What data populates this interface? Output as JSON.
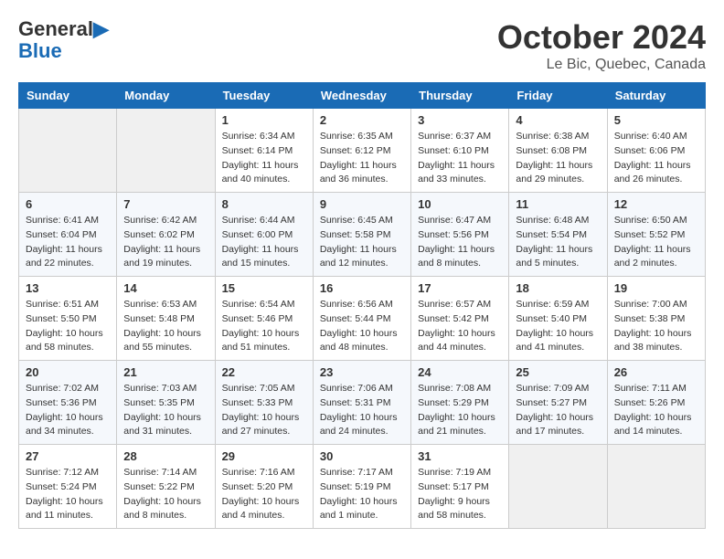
{
  "header": {
    "logo_line1": "General",
    "logo_line2": "Blue",
    "month": "October 2024",
    "location": "Le Bic, Quebec, Canada"
  },
  "days_of_week": [
    "Sunday",
    "Monday",
    "Tuesday",
    "Wednesday",
    "Thursday",
    "Friday",
    "Saturday"
  ],
  "weeks": [
    [
      {
        "num": "",
        "sunrise": "",
        "sunset": "",
        "daylight": ""
      },
      {
        "num": "",
        "sunrise": "",
        "sunset": "",
        "daylight": ""
      },
      {
        "num": "1",
        "sunrise": "Sunrise: 6:34 AM",
        "sunset": "Sunset: 6:14 PM",
        "daylight": "Daylight: 11 hours and 40 minutes."
      },
      {
        "num": "2",
        "sunrise": "Sunrise: 6:35 AM",
        "sunset": "Sunset: 6:12 PM",
        "daylight": "Daylight: 11 hours and 36 minutes."
      },
      {
        "num": "3",
        "sunrise": "Sunrise: 6:37 AM",
        "sunset": "Sunset: 6:10 PM",
        "daylight": "Daylight: 11 hours and 33 minutes."
      },
      {
        "num": "4",
        "sunrise": "Sunrise: 6:38 AM",
        "sunset": "Sunset: 6:08 PM",
        "daylight": "Daylight: 11 hours and 29 minutes."
      },
      {
        "num": "5",
        "sunrise": "Sunrise: 6:40 AM",
        "sunset": "Sunset: 6:06 PM",
        "daylight": "Daylight: 11 hours and 26 minutes."
      }
    ],
    [
      {
        "num": "6",
        "sunrise": "Sunrise: 6:41 AM",
        "sunset": "Sunset: 6:04 PM",
        "daylight": "Daylight: 11 hours and 22 minutes."
      },
      {
        "num": "7",
        "sunrise": "Sunrise: 6:42 AM",
        "sunset": "Sunset: 6:02 PM",
        "daylight": "Daylight: 11 hours and 19 minutes."
      },
      {
        "num": "8",
        "sunrise": "Sunrise: 6:44 AM",
        "sunset": "Sunset: 6:00 PM",
        "daylight": "Daylight: 11 hours and 15 minutes."
      },
      {
        "num": "9",
        "sunrise": "Sunrise: 6:45 AM",
        "sunset": "Sunset: 5:58 PM",
        "daylight": "Daylight: 11 hours and 12 minutes."
      },
      {
        "num": "10",
        "sunrise": "Sunrise: 6:47 AM",
        "sunset": "Sunset: 5:56 PM",
        "daylight": "Daylight: 11 hours and 8 minutes."
      },
      {
        "num": "11",
        "sunrise": "Sunrise: 6:48 AM",
        "sunset": "Sunset: 5:54 PM",
        "daylight": "Daylight: 11 hours and 5 minutes."
      },
      {
        "num": "12",
        "sunrise": "Sunrise: 6:50 AM",
        "sunset": "Sunset: 5:52 PM",
        "daylight": "Daylight: 11 hours and 2 minutes."
      }
    ],
    [
      {
        "num": "13",
        "sunrise": "Sunrise: 6:51 AM",
        "sunset": "Sunset: 5:50 PM",
        "daylight": "Daylight: 10 hours and 58 minutes."
      },
      {
        "num": "14",
        "sunrise": "Sunrise: 6:53 AM",
        "sunset": "Sunset: 5:48 PM",
        "daylight": "Daylight: 10 hours and 55 minutes."
      },
      {
        "num": "15",
        "sunrise": "Sunrise: 6:54 AM",
        "sunset": "Sunset: 5:46 PM",
        "daylight": "Daylight: 10 hours and 51 minutes."
      },
      {
        "num": "16",
        "sunrise": "Sunrise: 6:56 AM",
        "sunset": "Sunset: 5:44 PM",
        "daylight": "Daylight: 10 hours and 48 minutes."
      },
      {
        "num": "17",
        "sunrise": "Sunrise: 6:57 AM",
        "sunset": "Sunset: 5:42 PM",
        "daylight": "Daylight: 10 hours and 44 minutes."
      },
      {
        "num": "18",
        "sunrise": "Sunrise: 6:59 AM",
        "sunset": "Sunset: 5:40 PM",
        "daylight": "Daylight: 10 hours and 41 minutes."
      },
      {
        "num": "19",
        "sunrise": "Sunrise: 7:00 AM",
        "sunset": "Sunset: 5:38 PM",
        "daylight": "Daylight: 10 hours and 38 minutes."
      }
    ],
    [
      {
        "num": "20",
        "sunrise": "Sunrise: 7:02 AM",
        "sunset": "Sunset: 5:36 PM",
        "daylight": "Daylight: 10 hours and 34 minutes."
      },
      {
        "num": "21",
        "sunrise": "Sunrise: 7:03 AM",
        "sunset": "Sunset: 5:35 PM",
        "daylight": "Daylight: 10 hours and 31 minutes."
      },
      {
        "num": "22",
        "sunrise": "Sunrise: 7:05 AM",
        "sunset": "Sunset: 5:33 PM",
        "daylight": "Daylight: 10 hours and 27 minutes."
      },
      {
        "num": "23",
        "sunrise": "Sunrise: 7:06 AM",
        "sunset": "Sunset: 5:31 PM",
        "daylight": "Daylight: 10 hours and 24 minutes."
      },
      {
        "num": "24",
        "sunrise": "Sunrise: 7:08 AM",
        "sunset": "Sunset: 5:29 PM",
        "daylight": "Daylight: 10 hours and 21 minutes."
      },
      {
        "num": "25",
        "sunrise": "Sunrise: 7:09 AM",
        "sunset": "Sunset: 5:27 PM",
        "daylight": "Daylight: 10 hours and 17 minutes."
      },
      {
        "num": "26",
        "sunrise": "Sunrise: 7:11 AM",
        "sunset": "Sunset: 5:26 PM",
        "daylight": "Daylight: 10 hours and 14 minutes."
      }
    ],
    [
      {
        "num": "27",
        "sunrise": "Sunrise: 7:12 AM",
        "sunset": "Sunset: 5:24 PM",
        "daylight": "Daylight: 10 hours and 11 minutes."
      },
      {
        "num": "28",
        "sunrise": "Sunrise: 7:14 AM",
        "sunset": "Sunset: 5:22 PM",
        "daylight": "Daylight: 10 hours and 8 minutes."
      },
      {
        "num": "29",
        "sunrise": "Sunrise: 7:16 AM",
        "sunset": "Sunset: 5:20 PM",
        "daylight": "Daylight: 10 hours and 4 minutes."
      },
      {
        "num": "30",
        "sunrise": "Sunrise: 7:17 AM",
        "sunset": "Sunset: 5:19 PM",
        "daylight": "Daylight: 10 hours and 1 minute."
      },
      {
        "num": "31",
        "sunrise": "Sunrise: 7:19 AM",
        "sunset": "Sunset: 5:17 PM",
        "daylight": "Daylight: 9 hours and 58 minutes."
      },
      {
        "num": "",
        "sunrise": "",
        "sunset": "",
        "daylight": ""
      },
      {
        "num": "",
        "sunrise": "",
        "sunset": "",
        "daylight": ""
      }
    ]
  ]
}
